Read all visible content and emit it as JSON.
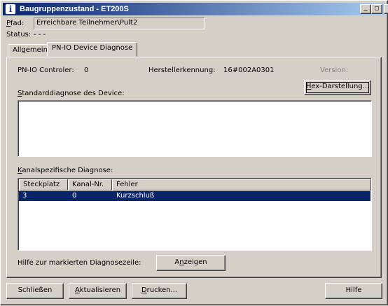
{
  "window": {
    "title": "Baugruppenzustand - ET200S",
    "controls": {
      "minimize": "_",
      "maximize": "□",
      "close": "×"
    }
  },
  "path": {
    "label_underlined": "P",
    "label_rest": "fad:",
    "value": "Erreichbare Teilnehmer\\Pult2"
  },
  "status": {
    "label": "Status:",
    "value": "- - -"
  },
  "tabs": [
    {
      "label": "Allgemein",
      "active": false
    },
    {
      "label": "PN-IO Device Diagnose",
      "active": true
    }
  ],
  "panel": {
    "controller_label": "PN-IO Controler:",
    "controller_value": "0",
    "vendor_label": "Herstellerkennung:",
    "vendor_value": "16#002A0301",
    "version_label": "Version:",
    "hex_button": {
      "u": "H",
      "rest": "ex-Darstellung..."
    },
    "std_diag_label": {
      "u": "S",
      "rest": "tandarddiagnose des Device:"
    },
    "channel_diag_label": {
      "u": "K",
      "rest": "analspezifische Diagnose:"
    },
    "table": {
      "columns": [
        "Steckplatz",
        "Kanal-Nr.",
        "Fehler"
      ],
      "rows": [
        {
          "slot": "3",
          "channel": "0",
          "error": "Kurzschluß",
          "selected": true
        }
      ]
    },
    "help_label": "Hilfe zur markierten Diagnosezeile:",
    "show_button": {
      "pre": "A",
      "u": "n",
      "rest": "zeigen"
    }
  },
  "footer": {
    "close_button": "Schließen",
    "refresh_button": {
      "u": "A",
      "rest": "ktualisieren"
    },
    "print_button": {
      "u": "D",
      "rest": "rucken..."
    },
    "help_button": "Hilfe"
  }
}
